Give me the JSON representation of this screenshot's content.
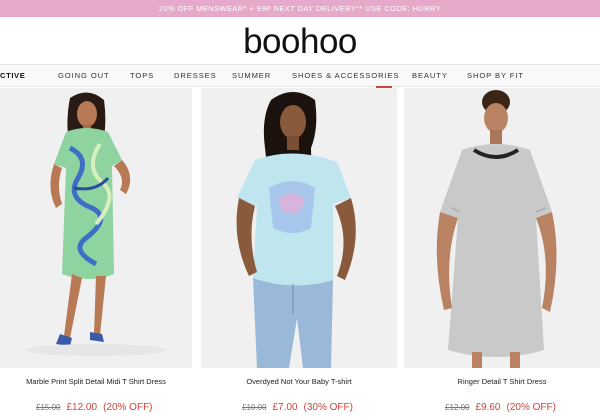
{
  "promo_banner": "20% OFF MENSWEAR* + 99P NEXT DAY DELIVERY** USE CODE: HURRY",
  "logo_text": "boohoo",
  "nav": {
    "items": [
      "CTIVE",
      "GOING OUT",
      "TOPS",
      "DRESSES",
      "SUMMER",
      "SHOES & ACCESSORIES",
      "BEAUTY",
      "SHOP BY FIT"
    ],
    "active": "SHOES & ACCESSORIES"
  },
  "products": [
    {
      "name": "Marble Print Split Detail Midi T Shirt Dress",
      "old_price": "£15.00",
      "price": "£12.00",
      "discount": "(20% OFF)"
    },
    {
      "name": "Overdyed Not Your Baby T-shirt",
      "old_price": "£10.00",
      "price": "£7.00",
      "discount": "(30% OFF)"
    },
    {
      "name": "Ringer Detail T Shirt Dress",
      "old_price": "£12.00",
      "price": "£9.60",
      "discount": "(20% OFF)"
    }
  ],
  "colors": {
    "promo_bg": "#e6a9c9",
    "sale_red": "#c9463d"
  }
}
